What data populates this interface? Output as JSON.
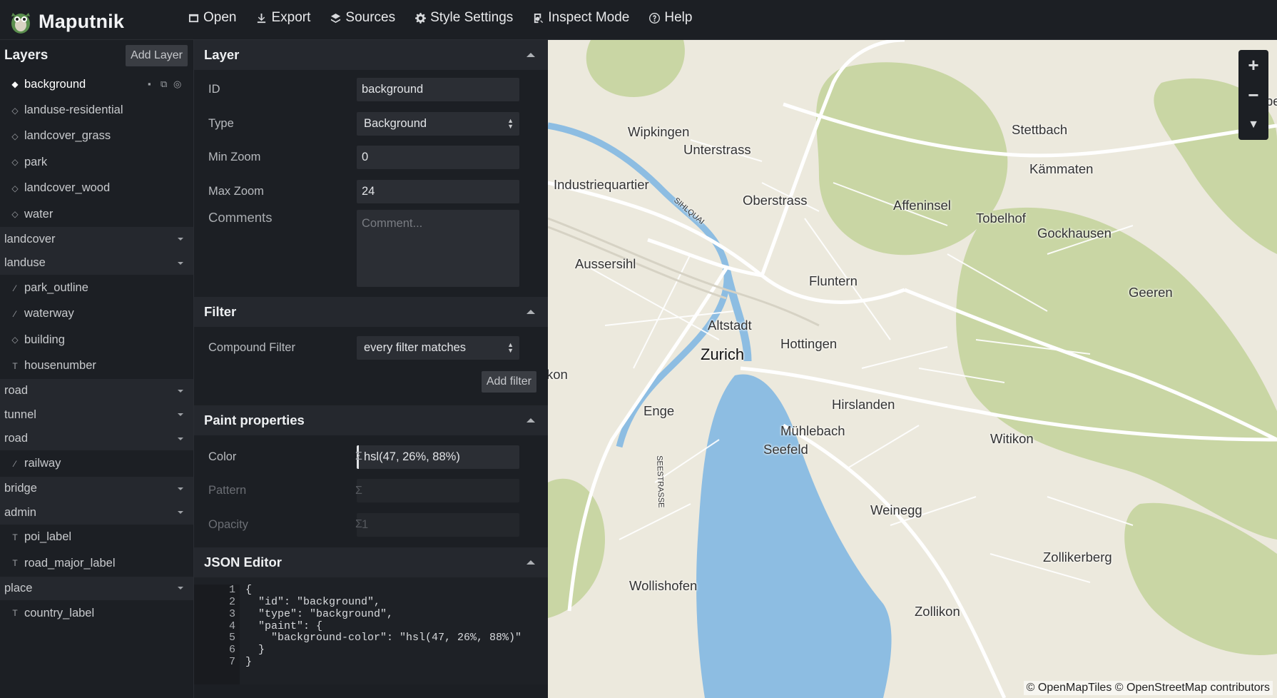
{
  "app": {
    "title": "Maputnik"
  },
  "nav": [
    {
      "label": "Open",
      "icon": "open-icon"
    },
    {
      "label": "Export",
      "icon": "download-icon"
    },
    {
      "label": "Sources",
      "icon": "layers-icon"
    },
    {
      "label": "Style Settings",
      "icon": "gear-icon"
    },
    {
      "label": "Inspect Mode",
      "icon": "inspect-icon"
    },
    {
      "label": "Help",
      "icon": "help-icon"
    }
  ],
  "layers": {
    "title": "Layers",
    "add_label": "Add Layer",
    "items": [
      {
        "kind": "layer",
        "name": "background",
        "icon": "fill-icon",
        "selected": true
      },
      {
        "kind": "layer",
        "name": "landuse-residential",
        "icon": "fill-icon"
      },
      {
        "kind": "layer",
        "name": "landcover_grass",
        "icon": "fill-icon"
      },
      {
        "kind": "layer",
        "name": "park",
        "icon": "fill-icon"
      },
      {
        "kind": "layer",
        "name": "landcover_wood",
        "icon": "fill-icon"
      },
      {
        "kind": "layer",
        "name": "water",
        "icon": "fill-icon"
      },
      {
        "kind": "group",
        "name": "landcover"
      },
      {
        "kind": "group",
        "name": "landuse"
      },
      {
        "kind": "layer",
        "name": "park_outline",
        "icon": "line-icon"
      },
      {
        "kind": "layer",
        "name": "waterway",
        "icon": "line-icon"
      },
      {
        "kind": "layer",
        "name": "building",
        "icon": "fill-icon"
      },
      {
        "kind": "layer",
        "name": "housenumber",
        "icon": "symbol-icon"
      },
      {
        "kind": "group",
        "name": "road"
      },
      {
        "kind": "group",
        "name": "tunnel"
      },
      {
        "kind": "group",
        "name": "road"
      },
      {
        "kind": "layer",
        "name": "railway",
        "icon": "line-icon"
      },
      {
        "kind": "group",
        "name": "bridge"
      },
      {
        "kind": "group",
        "name": "admin"
      },
      {
        "kind": "layer",
        "name": "poi_label",
        "icon": "symbol-icon"
      },
      {
        "kind": "layer",
        "name": "road_major_label",
        "icon": "symbol-icon"
      },
      {
        "kind": "group",
        "name": "place"
      },
      {
        "kind": "layer",
        "name": "country_label",
        "icon": "symbol-icon"
      }
    ]
  },
  "editor": {
    "layer": {
      "title": "Layer",
      "id_label": "ID",
      "id_value": "background",
      "type_label": "Type",
      "type_value": "Background",
      "minzoom_label": "Min Zoom",
      "minzoom_value": "0",
      "maxzoom_label": "Max Zoom",
      "maxzoom_value": "24",
      "comments_label": "Comments",
      "comments_placeholder": "Comment..."
    },
    "filter": {
      "title": "Filter",
      "compound_label": "Compound Filter",
      "compound_value": "every filter matches",
      "add_label": "Add filter"
    },
    "paint": {
      "title": "Paint properties",
      "color_label": "Color",
      "color_value": "hsl(47, 26%, 88%)",
      "pattern_label": "Pattern",
      "pattern_value": "",
      "opacity_label": "Opacity",
      "opacity_value": "1",
      "sigma": "Σ"
    },
    "json": {
      "title": "JSON Editor",
      "line_numbers": [
        "1",
        "2",
        "3",
        "4",
        "5",
        "6",
        "7"
      ],
      "lines": [
        "{",
        "  \"id\": \"background\",",
        "  \"type\": \"background\",",
        "  \"paint\": {",
        "    \"background-color\": \"hsl(47, 26%, 88%)\"",
        "  }",
        "}"
      ]
    }
  },
  "map": {
    "places": [
      {
        "name": "Wipkingen"
      },
      {
        "name": "Unterstrass"
      },
      {
        "name": "Stettbach"
      },
      {
        "name": "Kämmaten"
      },
      {
        "name": "Industriequartier"
      },
      {
        "name": "Oberstrass"
      },
      {
        "name": "Affeninsel"
      },
      {
        "name": "Tobelhof"
      },
      {
        "name": "Gockhausen"
      },
      {
        "name": "SIHLQUAI"
      },
      {
        "name": "Aussersihl"
      },
      {
        "name": "Fluntern"
      },
      {
        "name": "Geeren"
      },
      {
        "name": "Altstadt"
      },
      {
        "name": "Zurich"
      },
      {
        "name": "Hottingen"
      },
      {
        "name": "kon"
      },
      {
        "name": "Enge"
      },
      {
        "name": "Hirslanden"
      },
      {
        "name": "SEESTRASSE"
      },
      {
        "name": "Mühlebach"
      },
      {
        "name": "Witikon"
      },
      {
        "name": "Seefeld"
      },
      {
        "name": "Weinegg"
      },
      {
        "name": "Zollikerberg"
      },
      {
        "name": "Wollishofen"
      },
      {
        "name": "Zollikon"
      },
      {
        "name": "be"
      }
    ],
    "attribution": "© OpenMapTiles © OpenStreetMap contributors",
    "colors": {
      "land": "#ece9dd",
      "water": "#8dbde2",
      "green": "#c9d6a4",
      "road": "#ffffff"
    }
  }
}
